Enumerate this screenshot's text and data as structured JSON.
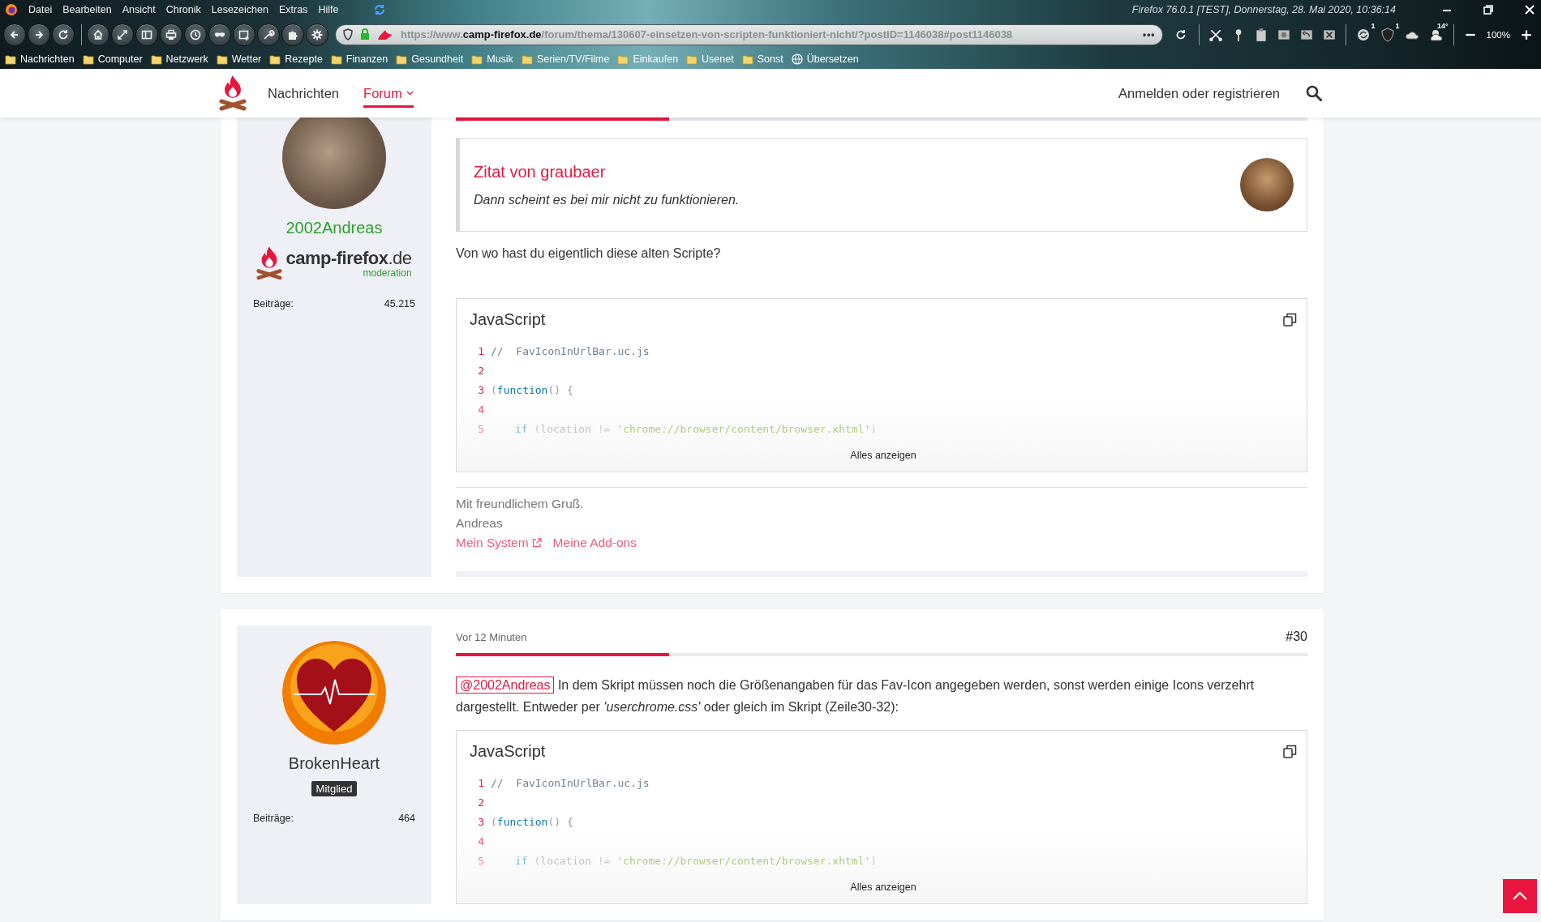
{
  "browser": {
    "menu": [
      "Datei",
      "Bearbeiten",
      "Ansicht",
      "Chronik",
      "Lesezeichen",
      "Extras",
      "Hilfe"
    ],
    "title": "Firefox 76.0.1 [TEST], Donnerstag, 28. Mai 2020, 10:36:14",
    "url": "https://www.**camp-firefox.de**/forum/thema/130607-einsetzen-von-scripten-funktioniert-nicht/?postID=1146038#post1146038",
    "url_more": "•••",
    "extensions": [
      {
        "kind": "sync",
        "badge": "1"
      },
      {
        "kind": "shield",
        "badge": "1"
      },
      {
        "kind": "cloud"
      },
      {
        "kind": "weather",
        "badge": "14°"
      }
    ],
    "zoom": "100%",
    "bookmarks": [
      {
        "kind": "folder",
        "label": "Nachrichten"
      },
      {
        "kind": "folder",
        "label": "Computer"
      },
      {
        "kind": "folder",
        "label": "Netzwerk"
      },
      {
        "kind": "folder",
        "label": "Wetter"
      },
      {
        "kind": "folder",
        "label": "Rezepte"
      },
      {
        "kind": "folder",
        "label": "Finanzen"
      },
      {
        "kind": "folder",
        "label": "Gesundheit"
      },
      {
        "kind": "folder",
        "label": "Musik"
      },
      {
        "kind": "folder",
        "label": "Serien/TV/Filme"
      },
      {
        "kind": "folder",
        "label": "Einkaufen"
      },
      {
        "kind": "folder",
        "label": "Usenet"
      },
      {
        "kind": "folder",
        "label": "Sonst"
      },
      {
        "kind": "globe",
        "label": "Übersetzen"
      }
    ]
  },
  "site": {
    "nav": [
      {
        "label": "Nachrichten",
        "selected": false,
        "dropdown": false
      },
      {
        "label": "Forum",
        "selected": true,
        "dropdown": true
      }
    ],
    "login": "Anmelden oder registrieren"
  },
  "posts": [
    {
      "author": {
        "name": "2002Andreas",
        "color": "#2e9e2e",
        "avatar": {
          "kind": "photo"
        },
        "rank": {
          "kind": "logo",
          "brand": "camp-firefox",
          "tld": ".de",
          "sub": "moderation"
        },
        "stats": [
          {
            "label": "Beiträge:",
            "value": "45.215"
          }
        ]
      },
      "blocks": [
        {
          "kind": "quote",
          "title": "Zitat von graubaer",
          "text": "Dann scheint es bei mir nicht zu funktionieren."
        },
        {
          "kind": "text",
          "text": "Von wo hast du eigentlich diese alten Scripte?"
        },
        {
          "kind": "code",
          "title": "JavaScript",
          "more": "Alles anzeigen",
          "lines": [
            {
              "number": "1",
              "indent": false,
              "tokens": [
                {
                  "kind": "comment",
                  "text": "//  FavIconInUrlBar.uc.js"
                }
              ]
            },
            {
              "number": "2"
            },
            {
              "number": "3",
              "indent": false,
              "tokens": [
                {
                  "kind": "punct",
                  "text": "("
                },
                {
                  "kind": "keyword",
                  "text": "function"
                },
                {
                  "kind": "punct",
                  "text": "() {"
                }
              ]
            },
            {
              "number": "4"
            },
            {
              "number": "5",
              "indent": true,
              "tokens": [
                {
                  "kind": "keyword",
                  "text": "if"
                },
                {
                  "kind": "punct",
                  "text": " ("
                },
                {
                  "kind": "plain",
                  "text": "location"
                },
                {
                  "kind": "punct",
                  "text": " != "
                },
                {
                  "kind": "string",
                  "text": "'chrome://browser/content/browser.xhtml'"
                },
                {
                  "kind": "punct",
                  "text": ")"
                }
              ]
            }
          ]
        }
      ],
      "signature": {
        "lines": [
          "Mit freundlichem Gruß.",
          "Andreas"
        ],
        "links": [
          {
            "label": "Mein System",
            "external": true
          },
          {
            "label": "Meine Add-ons",
            "external": false
          }
        ]
      }
    },
    {
      "author": {
        "name": "BrokenHeart",
        "color": "#333333",
        "avatar": {
          "kind": "heart"
        },
        "rank": {
          "kind": "badge",
          "label": "Mitglied"
        },
        "stats": [
          {
            "label": "Beiträge:",
            "value": "464"
          }
        ]
      },
      "date": "Vor 12 Minuten",
      "number": "#30",
      "blocks": [
        {
          "kind": "text",
          "mention": "@2002Andreas",
          "text": "In dem Skript müssen noch die Größenangaben für das Fav-Icon angegeben werden, sonst werden einige Icons verzehrt dargestellt. Entweder per *'userchrome.css'* oder gleich im Skript (Zeile30-32):"
        },
        {
          "kind": "code",
          "title": "JavaScript",
          "more": "Alles anzeigen",
          "lines": [
            {
              "number": "1",
              "indent": false,
              "tokens": [
                {
                  "kind": "comment",
                  "text": "//  FavIconInUrlBar.uc.js"
                }
              ]
            },
            {
              "number": "2"
            },
            {
              "number": "3",
              "indent": false,
              "tokens": [
                {
                  "kind": "punct",
                  "text": "("
                },
                {
                  "kind": "keyword",
                  "text": "function"
                },
                {
                  "kind": "punct",
                  "text": "() {"
                }
              ]
            },
            {
              "number": "4"
            },
            {
              "number": "5",
              "indent": true,
              "tokens": [
                {
                  "kind": "keyword",
                  "text": "if"
                },
                {
                  "kind": "punct",
                  "text": " ("
                },
                {
                  "kind": "plain",
                  "text": "location"
                },
                {
                  "kind": "punct",
                  "text": " != "
                },
                {
                  "kind": "string",
                  "text": "'chrome://browser/content/browser.xhtml'"
                },
                {
                  "kind": "punct",
                  "text": ")"
                }
              ]
            }
          ]
        }
      ]
    }
  ]
}
